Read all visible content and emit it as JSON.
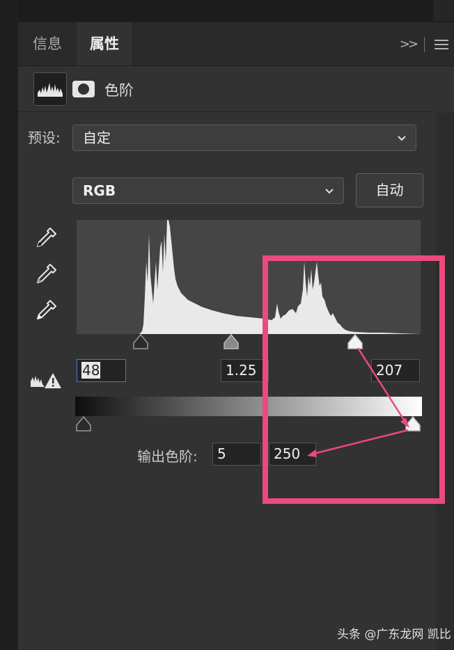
{
  "tabs": [
    {
      "label": "信息",
      "active": false
    },
    {
      "label": "属性",
      "active": true
    }
  ],
  "panel": {
    "title": "色阶",
    "expand_icon": "double-chevron-right-icon",
    "menu_icon": "hamburger-menu-icon"
  },
  "preset": {
    "label": "预设:",
    "value": "自定"
  },
  "channel": {
    "value": "RGB"
  },
  "auto_button": "自动",
  "input_levels": {
    "black": "48",
    "gamma": "1.25",
    "white": "207"
  },
  "output_levels": {
    "label": "输出色阶:",
    "black": "5",
    "white": "250"
  },
  "annotation": {
    "color": "#ec4a7c"
  },
  "watermark": "头条 @广东龙网 凯比"
}
